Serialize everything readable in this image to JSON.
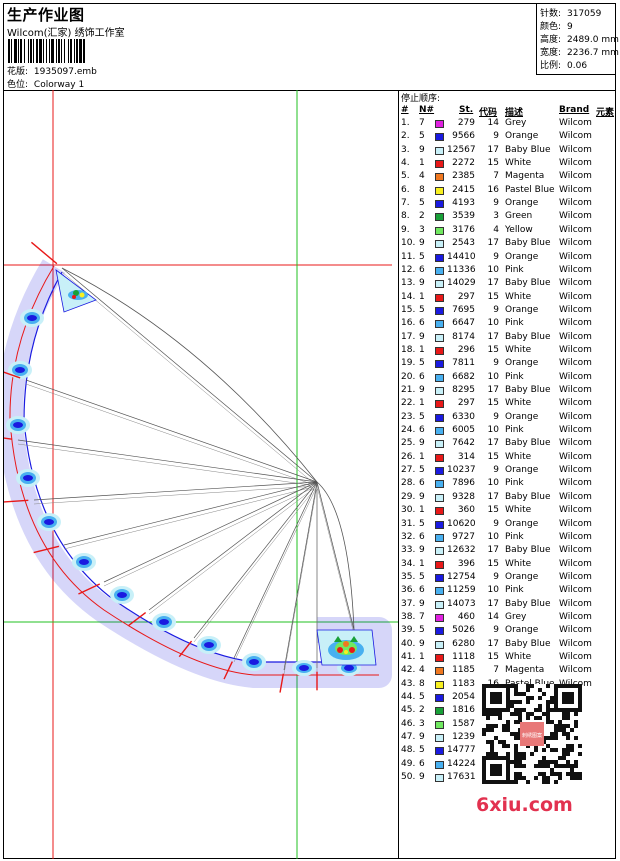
{
  "header": {
    "title": "生产作业图",
    "company": "Wilcom(汇家) 绣饰工作室",
    "design_label": "花版:",
    "design_file": "1935097.emb",
    "colorway_label": "色位:",
    "colorway": "Colorway 1"
  },
  "stats": [
    {
      "label": "针数:",
      "value": "317059"
    },
    {
      "label": "颜色:",
      "value": "9"
    },
    {
      "label": "高度:",
      "value": "2489.0 mm"
    },
    {
      "label": "宽度:",
      "value": "2236.7 mm"
    },
    {
      "label": "比例:",
      "value": "0.06"
    }
  ],
  "stop_sequence": {
    "title": "停止顺序:",
    "headers": {
      "num": "#",
      "needle": "N#",
      "stitches": "St.",
      "code": "代码",
      "description": "描述",
      "brand": "Brand",
      "element": "元素"
    },
    "rows": [
      {
        "num": "1.",
        "needle": "7",
        "color": "#e020e0",
        "stitches": "279",
        "code": "14",
        "desc": "Grey",
        "brand": "Wilcom"
      },
      {
        "num": "2.",
        "needle": "5",
        "color": "#1a1ae0",
        "stitches": "9566",
        "code": "9",
        "desc": "Orange",
        "brand": "Wilcom"
      },
      {
        "num": "3.",
        "needle": "9",
        "color": "#c8f0f8",
        "stitches": "12567",
        "code": "17",
        "desc": "Baby Blue",
        "brand": "Wilcom"
      },
      {
        "num": "4.",
        "needle": "1",
        "color": "#e81818",
        "stitches": "2272",
        "code": "15",
        "desc": "White",
        "brand": "Wilcom"
      },
      {
        "num": "5.",
        "needle": "4",
        "color": "#f07820",
        "stitches": "2385",
        "code": "7",
        "desc": "Magenta",
        "brand": "Wilcom"
      },
      {
        "num": "6.",
        "needle": "8",
        "color": "#f8f020",
        "stitches": "2415",
        "code": "16",
        "desc": "Pastel Blue",
        "brand": "Wilcom"
      },
      {
        "num": "7.",
        "needle": "5",
        "color": "#1a1ae0",
        "stitches": "4193",
        "code": "9",
        "desc": "Orange",
        "brand": "Wilcom"
      },
      {
        "num": "8.",
        "needle": "2",
        "color": "#18a038",
        "stitches": "3539",
        "code": "3",
        "desc": "Green",
        "brand": "Wilcom"
      },
      {
        "num": "9.",
        "needle": "3",
        "color": "#70e860",
        "stitches": "3176",
        "code": "4",
        "desc": "Yellow",
        "brand": "Wilcom"
      },
      {
        "num": "10.",
        "needle": "9",
        "color": "#c8f0f8",
        "stitches": "2543",
        "code": "17",
        "desc": "Baby Blue",
        "brand": "Wilcom"
      },
      {
        "num": "11.",
        "needle": "5",
        "color": "#1a1ae0",
        "stitches": "14410",
        "code": "9",
        "desc": "Orange",
        "brand": "Wilcom"
      },
      {
        "num": "12.",
        "needle": "6",
        "color": "#48b0f0",
        "stitches": "11336",
        "code": "10",
        "desc": "Pink",
        "brand": "Wilcom"
      },
      {
        "num": "13.",
        "needle": "9",
        "color": "#c8f0f8",
        "stitches": "14029",
        "code": "17",
        "desc": "Baby Blue",
        "brand": "Wilcom"
      },
      {
        "num": "14.",
        "needle": "1",
        "color": "#e81818",
        "stitches": "297",
        "code": "15",
        "desc": "White",
        "brand": "Wilcom"
      },
      {
        "num": "15.",
        "needle": "5",
        "color": "#1a1ae0",
        "stitches": "7695",
        "code": "9",
        "desc": "Orange",
        "brand": "Wilcom"
      },
      {
        "num": "16.",
        "needle": "6",
        "color": "#48b0f0",
        "stitches": "6647",
        "code": "10",
        "desc": "Pink",
        "brand": "Wilcom"
      },
      {
        "num": "17.",
        "needle": "9",
        "color": "#c8f0f8",
        "stitches": "8174",
        "code": "17",
        "desc": "Baby Blue",
        "brand": "Wilcom"
      },
      {
        "num": "18.",
        "needle": "1",
        "color": "#e81818",
        "stitches": "296",
        "code": "15",
        "desc": "White",
        "brand": "Wilcom"
      },
      {
        "num": "19.",
        "needle": "5",
        "color": "#1a1ae0",
        "stitches": "7811",
        "code": "9",
        "desc": "Orange",
        "brand": "Wilcom"
      },
      {
        "num": "20.",
        "needle": "6",
        "color": "#48b0f0",
        "stitches": "6682",
        "code": "10",
        "desc": "Pink",
        "brand": "Wilcom"
      },
      {
        "num": "21.",
        "needle": "9",
        "color": "#c8f0f8",
        "stitches": "8295",
        "code": "17",
        "desc": "Baby Blue",
        "brand": "Wilcom"
      },
      {
        "num": "22.",
        "needle": "1",
        "color": "#e81818",
        "stitches": "297",
        "code": "15",
        "desc": "White",
        "brand": "Wilcom"
      },
      {
        "num": "23.",
        "needle": "5",
        "color": "#1a1ae0",
        "stitches": "6330",
        "code": "9",
        "desc": "Orange",
        "brand": "Wilcom"
      },
      {
        "num": "24.",
        "needle": "6",
        "color": "#48b0f0",
        "stitches": "6005",
        "code": "10",
        "desc": "Pink",
        "brand": "Wilcom"
      },
      {
        "num": "25.",
        "needle": "9",
        "color": "#c8f0f8",
        "stitches": "7642",
        "code": "17",
        "desc": "Baby Blue",
        "brand": "Wilcom"
      },
      {
        "num": "26.",
        "needle": "1",
        "color": "#e81818",
        "stitches": "314",
        "code": "15",
        "desc": "White",
        "brand": "Wilcom"
      },
      {
        "num": "27.",
        "needle": "5",
        "color": "#1a1ae0",
        "stitches": "10237",
        "code": "9",
        "desc": "Orange",
        "brand": "Wilcom"
      },
      {
        "num": "28.",
        "needle": "6",
        "color": "#48b0f0",
        "stitches": "7896",
        "code": "10",
        "desc": "Pink",
        "brand": "Wilcom"
      },
      {
        "num": "29.",
        "needle": "9",
        "color": "#c8f0f8",
        "stitches": "9328",
        "code": "17",
        "desc": "Baby Blue",
        "brand": "Wilcom"
      },
      {
        "num": "30.",
        "needle": "1",
        "color": "#e81818",
        "stitches": "360",
        "code": "15",
        "desc": "White",
        "brand": "Wilcom"
      },
      {
        "num": "31.",
        "needle": "5",
        "color": "#1a1ae0",
        "stitches": "10620",
        "code": "9",
        "desc": "Orange",
        "brand": "Wilcom"
      },
      {
        "num": "32.",
        "needle": "6",
        "color": "#48b0f0",
        "stitches": "9727",
        "code": "10",
        "desc": "Pink",
        "brand": "Wilcom"
      },
      {
        "num": "33.",
        "needle": "9",
        "color": "#c8f0f8",
        "stitches": "12632",
        "code": "17",
        "desc": "Baby Blue",
        "brand": "Wilcom"
      },
      {
        "num": "34.",
        "needle": "1",
        "color": "#e81818",
        "stitches": "396",
        "code": "15",
        "desc": "White",
        "brand": "Wilcom"
      },
      {
        "num": "35.",
        "needle": "5",
        "color": "#1a1ae0",
        "stitches": "12754",
        "code": "9",
        "desc": "Orange",
        "brand": "Wilcom"
      },
      {
        "num": "36.",
        "needle": "6",
        "color": "#48b0f0",
        "stitches": "11259",
        "code": "10",
        "desc": "Pink",
        "brand": "Wilcom"
      },
      {
        "num": "37.",
        "needle": "9",
        "color": "#c8f0f8",
        "stitches": "14073",
        "code": "17",
        "desc": "Baby Blue",
        "brand": "Wilcom"
      },
      {
        "num": "38.",
        "needle": "7",
        "color": "#e020e0",
        "stitches": "460",
        "code": "14",
        "desc": "Grey",
        "brand": "Wilcom"
      },
      {
        "num": "39.",
        "needle": "5",
        "color": "#1a1ae0",
        "stitches": "5026",
        "code": "9",
        "desc": "Orange",
        "brand": "Wilcom"
      },
      {
        "num": "40.",
        "needle": "9",
        "color": "#c8f0f8",
        "stitches": "6280",
        "code": "17",
        "desc": "Baby Blue",
        "brand": "Wilcom"
      },
      {
        "num": "41.",
        "needle": "1",
        "color": "#e81818",
        "stitches": "1118",
        "code": "15",
        "desc": "White",
        "brand": "Wilcom"
      },
      {
        "num": "42.",
        "needle": "4",
        "color": "#f07820",
        "stitches": "1185",
        "code": "7",
        "desc": "Magenta",
        "brand": "Wilcom"
      },
      {
        "num": "43.",
        "needle": "8",
        "color": "#f8f020",
        "stitches": "1183",
        "code": "16",
        "desc": "Pastel Blue",
        "brand": "Wilcom"
      },
      {
        "num": "44.",
        "needle": "5",
        "color": "#1a1ae0",
        "stitches": "2054",
        "code": "",
        "desc": "",
        "brand": ""
      },
      {
        "num": "45.",
        "needle": "2",
        "color": "#18a038",
        "stitches": "1816",
        "code": "",
        "desc": "",
        "brand": ""
      },
      {
        "num": "46.",
        "needle": "3",
        "color": "#70e860",
        "stitches": "1587",
        "code": "",
        "desc": "",
        "brand": ""
      },
      {
        "num": "47.",
        "needle": "9",
        "color": "#c8f0f8",
        "stitches": "1239",
        "code": "",
        "desc": "",
        "brand": ""
      },
      {
        "num": "48.",
        "needle": "5",
        "color": "#1a1ae0",
        "stitches": "14777",
        "code": "",
        "desc": "",
        "brand": ""
      },
      {
        "num": "49.",
        "needle": "6",
        "color": "#48b0f0",
        "stitches": "14224",
        "code": "",
        "desc": "",
        "brand": ""
      },
      {
        "num": "50.",
        "needle": "9",
        "color": "#c8f0f8",
        "stitches": "17631",
        "code": "",
        "desc": "",
        "brand": ""
      }
    ]
  },
  "watermark": "6xiu.com",
  "qr_stamp_text": "刺绣图案",
  "design_colors": {
    "dark_blue": "#1a1ae0",
    "mid_blue": "#48b0f0",
    "light_blue": "#c8f0f8",
    "guide_red": "#e81818",
    "guide_green": "#20c020"
  }
}
